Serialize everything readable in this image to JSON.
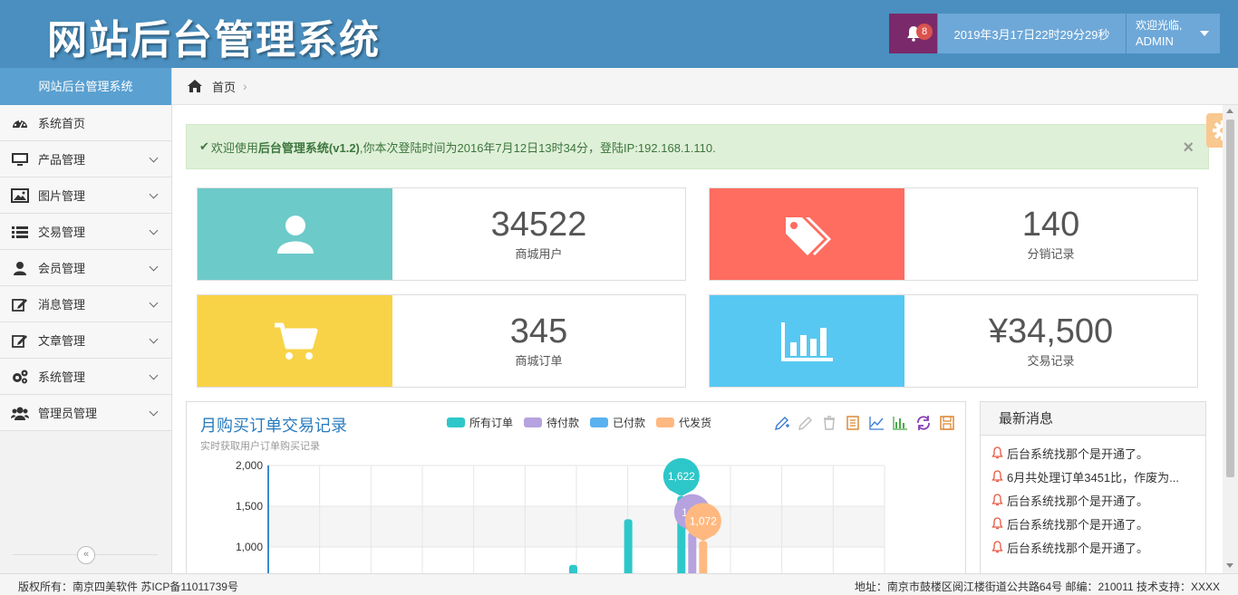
{
  "header": {
    "logo": "网站后台管理系统",
    "notification_count": "8",
    "datetime": "2019年3月17日22时29分29秒",
    "welcome": "欢迎光临,",
    "username": "ADMIN"
  },
  "sidebar": {
    "title": "网站后台管理系统",
    "items": [
      {
        "label": "系统首页",
        "icon": "dashboard-icon",
        "expandable": false
      },
      {
        "label": "产品管理",
        "icon": "monitor-icon",
        "expandable": true
      },
      {
        "label": "图片管理",
        "icon": "picture-icon",
        "expandable": true
      },
      {
        "label": "交易管理",
        "icon": "list-icon",
        "expandable": true
      },
      {
        "label": "会员管理",
        "icon": "user-icon",
        "expandable": true
      },
      {
        "label": "消息管理",
        "icon": "edit-icon",
        "expandable": true
      },
      {
        "label": "文章管理",
        "icon": "edit-icon",
        "expandable": true
      },
      {
        "label": "系统管理",
        "icon": "cogs-icon",
        "expandable": true
      },
      {
        "label": "管理员管理",
        "icon": "group-icon",
        "expandable": true
      }
    ],
    "collapse_glyph": "«"
  },
  "breadcrumb": {
    "home": "首页",
    "separator": "›"
  },
  "alert": {
    "prefix": "欢迎使用",
    "system_name": "后台管理系统(v1.2)",
    "suffix": ",你本次登陆时间为2016年7月12日13时34分，登陆IP:192.168.1.110.",
    "close": "×"
  },
  "stats": [
    {
      "value": "34522",
      "label": "商城用户",
      "color": "#6ccac9",
      "icon": "user-icon"
    },
    {
      "value": "140",
      "label": "分销记录",
      "color": "#ff6c60",
      "icon": "tags-icon"
    },
    {
      "value": "345",
      "label": "商城订单",
      "color": "#f8d347",
      "icon": "cart-icon"
    },
    {
      "value": "¥34,500",
      "label": "交易记录",
      "color": "#57c8f2",
      "icon": "bar-chart-icon"
    }
  ],
  "chart_panel": {
    "title": "月购买订单交易记录",
    "subtitle": "实时获取用户订单购买记录"
  },
  "chart_data": {
    "type": "bar",
    "series": [
      {
        "name": "所有订单",
        "color": "#2ec7c9"
      },
      {
        "name": "待付款",
        "color": "#b6a2de"
      },
      {
        "name": "已付款",
        "color": "#5ab1ef"
      },
      {
        "name": "代发货",
        "color": "#ffb980"
      }
    ],
    "y_ticks": [
      "2,000",
      "1,500",
      "1,000"
    ],
    "ylim": [
      0,
      2000
    ],
    "bars": [
      {
        "series": 0,
        "category": 6,
        "value": 780
      },
      {
        "series": 0,
        "category": 7,
        "value": 1340
      },
      {
        "series": 0,
        "category": 8,
        "value": 1622
      },
      {
        "series": 1,
        "category": 8,
        "value": 1180
      },
      {
        "series": 3,
        "category": 8,
        "value": 1072
      }
    ],
    "markers": [
      {
        "series": 0,
        "label": "1,622",
        "value": 1622
      },
      {
        "series": 1,
        "label": "1,18",
        "value": 1180
      },
      {
        "series": 3,
        "label": "1,072",
        "value": 1072
      }
    ],
    "grid": true,
    "legend_position": "top"
  },
  "news": {
    "title": "最新消息",
    "items": [
      "后台系统找那个是开通了。",
      "6月共处理订单3451比，作废为...",
      "后台系统找那个是开通了。",
      "后台系统找那个是开通了。",
      "后台系统找那个是开通了。"
    ]
  },
  "footer": {
    "left": "版权所有：南京四美软件  苏ICP备11011739号",
    "right": "地址：南京市鼓楼区阅江楼街道公共路64号 邮编：210011 技术支持：XXXX"
  }
}
